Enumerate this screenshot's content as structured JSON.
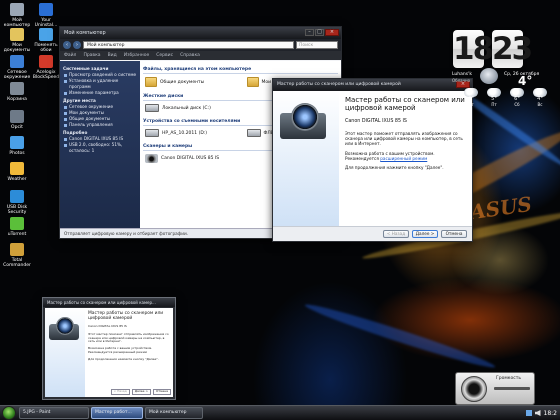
{
  "desktop": {
    "brand_text": "ASUS",
    "icons": [
      {
        "label": "Мой компьютер",
        "color": "#9aa6b5"
      },
      {
        "label": "Your Uninstal...",
        "color": "#2a6fd6"
      },
      {
        "label": "Мои документы",
        "color": "#e3c45d"
      },
      {
        "label": "Поменять обои",
        "color": "#4aa3e8"
      },
      {
        "label": "Сетевое окружение",
        "color": "#3c7fd6"
      },
      {
        "label": "Acelogix BlockSpeed",
        "color": "#d33a2a"
      },
      {
        "label": "Корзина",
        "color": "#7f8a96"
      },
      {
        "label": "Opcit",
        "color": "#6e7a88"
      },
      {
        "label": "Photos",
        "color": "#4aa0e8"
      },
      {
        "label": "Weather",
        "color": "#f0b93a"
      },
      {
        "label": "USB Disk Security",
        "color": "#2c8cd8"
      },
      {
        "label": "uTorrent",
        "color": "#5bbf3a"
      },
      {
        "label": "Total Commander",
        "color": "#d0a03a"
      }
    ]
  },
  "explorer": {
    "title": "Мой компьютер",
    "address": "Мой компьютер",
    "search_placeholder": "Поиск",
    "menu": [
      "Файл",
      "Правка",
      "Вид",
      "Избранное",
      "Сервис",
      "Справка"
    ],
    "sidebar": [
      {
        "heading": "Системные задачи",
        "items": [
          "Просмотр сведений о системе",
          "Установка и удаление программ",
          "Изменение параметра"
        ]
      },
      {
        "heading": "Другие места",
        "items": [
          "Сетевое окружение",
          "Мои документы",
          "Общие документы",
          "Панель управления"
        ]
      },
      {
        "heading": "Подробно",
        "items": [
          "Canon DIGITAL IXUS 85 IS",
          "USB 2.0, свободно: 51%, осталось: 1"
        ]
      }
    ],
    "groups": [
      {
        "title": "Файлы, хранящиеся на этом компьютере",
        "items": [
          "Общие документы",
          "Мои документы"
        ],
        "icon": "folder-icon"
      },
      {
        "title": "Жесткие диски",
        "items": [
          "Локальный диск (C:)"
        ],
        "icon": "drive-icon"
      },
      {
        "title": "Устройства со съемными носителями",
        "items": [
          "HP_AS_10.2011 (D:)",
          "ФЛЕШКА (E:)"
        ],
        "icon": "drive-icon"
      },
      {
        "title": "Сканеры и камеры",
        "items": [
          "Canon DIGITAL IXUS 85 IS"
        ],
        "icon": "camera-icon"
      }
    ],
    "status": "Отправляет цифровую камеру и отбирает фотографии.",
    "status_right": "Мой компьютер"
  },
  "wizard": {
    "title": "Мастер работы со сканером или цифровой камерой",
    "heading": "Мастер работы со сканером или цифровой камерой",
    "device": "Canon DIGITAL IXUS 85 IS",
    "para1": "Этот мастер поможет отправлять изображения со сканера или цифровой камеры на компьютер, в сеть или в Интернет.",
    "para2": "Возможна работа с вашим устройством. Рекомендуется",
    "link": "расширенный режим",
    "para3": "Для продолжения нажмите кнопку \"Далее\".",
    "buttons": {
      "back": "< Назад",
      "next": "Далее >",
      "cancel": "Отмена"
    }
  },
  "preview": {
    "title": "Мастер работы со сканером или цифровой камер...",
    "heading": "Мастер работы со сканером или цифровой камерой",
    "device": "Canon DIGITAL IXUS 85 IS",
    "para1": "Этот мастер поможет отправлять изображения со сканера или цифровой камеры на компьютер, в сеть или в Интернет.",
    "para2": "Возможна работа с вашим устройством. Рекомендуется расширенный режим",
    "para3": "Для продолжения нажмите кнопку \"Далее\".",
    "buttons": {
      "back": "< Назад",
      "next": "Далее >",
      "cancel": "Отмена"
    }
  },
  "clock": {
    "hours": "18",
    "minutes": "23",
    "city": "Luhans'k",
    "condition": "Облачно",
    "date": "Ср, 26 октября",
    "temp": "4°"
  },
  "forecast": [
    {
      "day": "Чт",
      "temp": "4°"
    },
    {
      "day": "Пт",
      "temp": "5°"
    },
    {
      "day": "Сб",
      "temp": "6°"
    },
    {
      "day": "Вс",
      "temp": "4°"
    }
  ],
  "volume": {
    "label": "Громкость"
  },
  "taskbar": {
    "items": [
      {
        "label": "5.JPG - Paint",
        "active": false
      },
      {
        "label": "Мастер работ...",
        "active": true
      },
      {
        "label": "Мой компьютер",
        "active": false
      }
    ],
    "time": "18:2"
  }
}
